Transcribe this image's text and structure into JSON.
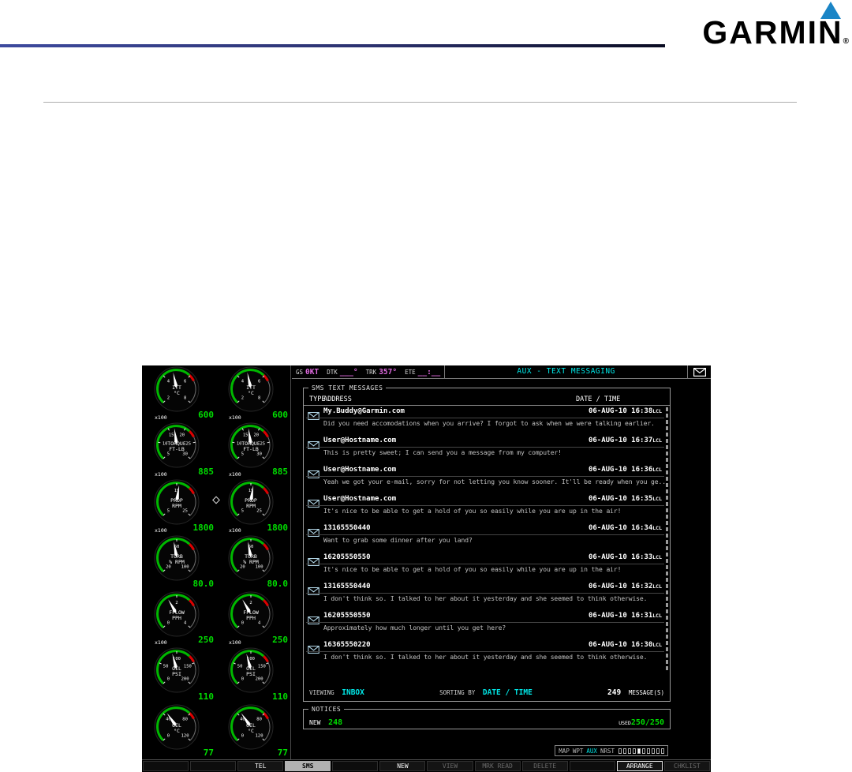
{
  "colors": {
    "cyan": "#00e7e7",
    "green": "#00dc00",
    "magenta": "#e06ae0",
    "garmin_blue": "#1b85c6"
  },
  "page": {
    "brand": "GARMIN",
    "registered": "®"
  },
  "mfd": {
    "navbar": {
      "fields": [
        {
          "label": "GS",
          "value": "0KT"
        },
        {
          "label": "DTK",
          "value": "___°"
        },
        {
          "label": "TRK",
          "value": "357°"
        },
        {
          "label": "ETE",
          "value": "__:__"
        }
      ],
      "title": "AUX - TEXT MESSAGING"
    },
    "sms": {
      "box_title": "SMS TEXT MESSAGES",
      "columns": {
        "type": "TYPE",
        "address": "ADDRESS",
        "datetime": "DATE / TIME"
      },
      "messages": [
        {
          "address": "My.Buddy@Garmin.com",
          "datetime": "06-AUG-10 16:38",
          "tz": "LCL",
          "preview": "Did you need accomodations when you arrive? I forgot to ask when we were talking earlier."
        },
        {
          "address": "User@Hostname.com",
          "datetime": "06-AUG-10 16:37",
          "tz": "LCL",
          "preview": "This is pretty sweet; I can send you a message from my computer!"
        },
        {
          "address": "User@Hostname.com",
          "datetime": "06-AUG-10 16:36",
          "tz": "LCL",
          "preview": "Yeah we got your e-mail, sorry for not letting you know sooner. It'll be ready when you ge..."
        },
        {
          "address": "User@Hostname.com",
          "datetime": "06-AUG-10 16:35",
          "tz": "LCL",
          "preview": "It's nice to be able to get a hold of you so easily while you are up in the air!"
        },
        {
          "address": "13165550440",
          "datetime": "06-AUG-10 16:34",
          "tz": "LCL",
          "preview": "Want to grab some dinner after you land?"
        },
        {
          "address": "16205550550",
          "datetime": "06-AUG-10 16:33",
          "tz": "LCL",
          "preview": "It's nice to be able to get a hold of you so easily while you are up in the air!"
        },
        {
          "address": "13165550440",
          "datetime": "06-AUG-10 16:32",
          "tz": "LCL",
          "preview": "I don't think so. I talked to her about it yesterday and she seemed to think otherwise."
        },
        {
          "address": "16205550550",
          "datetime": "06-AUG-10 16:31",
          "tz": "LCL",
          "preview": "Approximately how much longer until you get here?"
        },
        {
          "address": "16365550220",
          "datetime": "06-AUG-10 16:30",
          "tz": "LCL",
          "preview": "I don't think so. I talked to her about it yesterday and she seemed to think otherwise."
        }
      ],
      "footer": {
        "viewing_label": "VIEWING",
        "viewing_value": "INBOX",
        "sorting_label": "SORTING BY",
        "sorting_value": "DATE / TIME",
        "count": "249",
        "count_label": "MESSAGE(S)"
      }
    },
    "notices": {
      "title": "NOTICES",
      "new_label": "NEW",
      "new_value": "248",
      "used_label": "USED",
      "used_value": "250/250"
    },
    "pagegroup": {
      "groups": [
        "MAP",
        "WPT",
        "AUX",
        "NRST"
      ],
      "active": "AUX",
      "box_count": 10,
      "active_box": 4
    },
    "softkeys": [
      {
        "label": "",
        "state": "blank"
      },
      {
        "label": "",
        "state": "blank"
      },
      {
        "label": "TEL",
        "state": "normal"
      },
      {
        "label": "SMS",
        "state": "selected"
      },
      {
        "label": "",
        "state": "blank"
      },
      {
        "label": "NEW",
        "state": "normal"
      },
      {
        "label": "VIEW",
        "state": "disabled"
      },
      {
        "label": "MRK READ",
        "state": "disabled"
      },
      {
        "label": "DELETE",
        "state": "disabled"
      },
      {
        "label": "",
        "state": "blank"
      },
      {
        "label": "ARRANGE",
        "state": "boxed"
      },
      {
        "label": "CHKLIST",
        "state": "disabled"
      }
    ]
  },
  "eis": {
    "gauges": [
      {
        "name": "ITT",
        "unit": "°C",
        "mult": "x100",
        "value": "600",
        "ticks": [
          "2",
          "4",
          "6",
          "8"
        ],
        "needle": -12
      },
      {
        "name": "TORQUE",
        "unit": "FT-LB",
        "mult": "x100",
        "value": "885",
        "ticks": [
          "5",
          "10",
          "15",
          "20",
          "25",
          "30"
        ],
        "needle": -8
      },
      {
        "name": "PROP",
        "unit": "RPM",
        "mult": "x100",
        "value": "1800",
        "ticks": [
          "5",
          "15",
          "25"
        ],
        "needle": 8
      },
      {
        "name": "TURB",
        "unit": "% RPM",
        "mult": "",
        "value": "80.0",
        "ticks": [
          "20",
          "60",
          "100"
        ],
        "needle": -10
      },
      {
        "name": "FFLOW",
        "unit": "PPH",
        "mult": "x100",
        "value": "250",
        "ticks": [
          "0",
          "2",
          "4"
        ],
        "needle": -30
      },
      {
        "name": "OIL",
        "unit": "PSI",
        "mult": "",
        "value": "110",
        "ticks": [
          "0",
          "50",
          "100",
          "150",
          "200"
        ],
        "needle": -15
      },
      {
        "name": "OIL",
        "unit": "°C",
        "mult": "",
        "value": "77",
        "ticks": [
          "0",
          "40",
          "80",
          "120"
        ],
        "needle": -35
      }
    ]
  }
}
